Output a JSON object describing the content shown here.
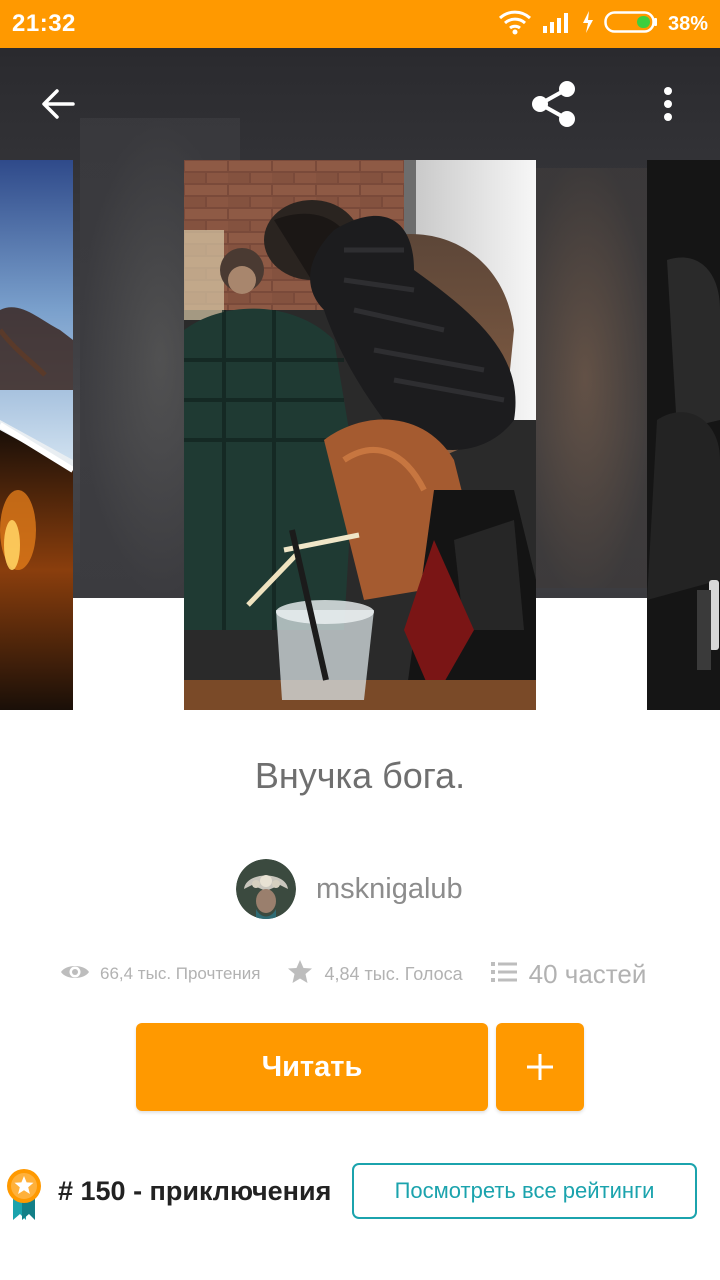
{
  "status_bar": {
    "time": "21:32",
    "battery": "38%"
  },
  "appbar": {
    "back_icon": "arrow-left-icon",
    "share_icon": "share-icon",
    "more_icon": "more-vertical-icon"
  },
  "story": {
    "title": "Внучка бога.",
    "author": "msknigalub"
  },
  "stats": {
    "reads": "66,4 тыс. Прочтения",
    "votes": "4,84 тыс. Голоса",
    "parts": "40 частей"
  },
  "actions": {
    "read_label": "Читать",
    "add_label": "+"
  },
  "ranking": {
    "text": "# 150 - приключения",
    "button_label": "Посмотреть все рейтинги"
  },
  "colors": {
    "accent": "#FF9900",
    "teal": "#1BA3AD"
  }
}
